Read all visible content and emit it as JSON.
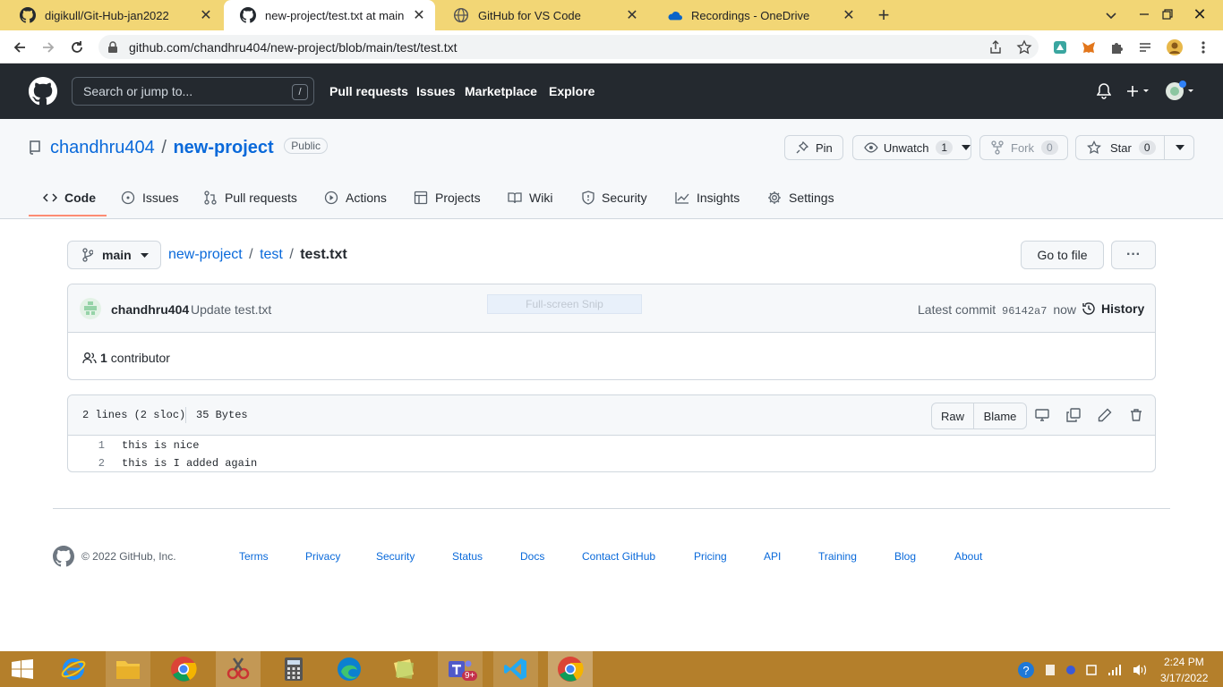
{
  "browser": {
    "tabs": [
      {
        "label": "digikull/Git-Hub-jan2022",
        "icon": "github-icon"
      },
      {
        "label": "new-project/test.txt at main · cha",
        "icon": "github-icon"
      },
      {
        "label": "GitHub for VS Code",
        "icon": "globe-icon"
      },
      {
        "label": "Recordings - OneDrive",
        "icon": "onedrive-icon"
      }
    ],
    "url": "github.com/chandhru404/new-project/blob/main/test/test.txt"
  },
  "header": {
    "search_placeholder": "Search or jump to...",
    "search_key": "/",
    "nav": [
      "Pull requests",
      "Issues",
      "Marketplace",
      "Explore"
    ]
  },
  "repo": {
    "owner": "chandhru404",
    "sep": "/",
    "name": "new-project",
    "visibility": "Public",
    "pin_label": "Pin",
    "unwatch_label": "Unwatch",
    "watch_count": "1",
    "fork_label": "Fork",
    "fork_count": "0",
    "star_label": "Star",
    "star_count": "0",
    "tabs": [
      "Code",
      "Issues",
      "Pull requests",
      "Actions",
      "Projects",
      "Wiki",
      "Security",
      "Insights",
      "Settings"
    ]
  },
  "file": {
    "branch": "main",
    "crumbs": [
      "new-project",
      "test",
      "test.txt"
    ],
    "goto_file": "Go to file",
    "more": "···",
    "commit_author": "chandhru404",
    "commit_message": "Update test.txt",
    "snip_overlay": "Full-screen Snip",
    "latest_commit_label": "Latest commit",
    "commit_sha": "96142a7",
    "commit_time": "now",
    "history_label": "History",
    "contributors_count": "1",
    "contributors_label": "contributor",
    "lines_info": "2 lines (2 sloc)",
    "size_info": "35 Bytes",
    "raw_label": "Raw",
    "blame_label": "Blame",
    "lines": [
      {
        "num": "1",
        "text": "this is nice"
      },
      {
        "num": "2",
        "text": "this is I added again"
      }
    ]
  },
  "footer": {
    "copyright": "© 2022 GitHub, Inc.",
    "links": [
      "Terms",
      "Privacy",
      "Security",
      "Status",
      "Docs",
      "Contact GitHub",
      "Pricing",
      "API",
      "Training",
      "Blog",
      "About"
    ]
  },
  "taskbar": {
    "time": "2:24 PM",
    "date": "3/17/2022",
    "teams_badge": "9+"
  },
  "colors": {
    "tabstrip": "#f2d675",
    "gh_header": "#24292f",
    "link": "#0969da",
    "active_tab_underline": "#fd8c73",
    "taskbar": "#b47f2b"
  }
}
